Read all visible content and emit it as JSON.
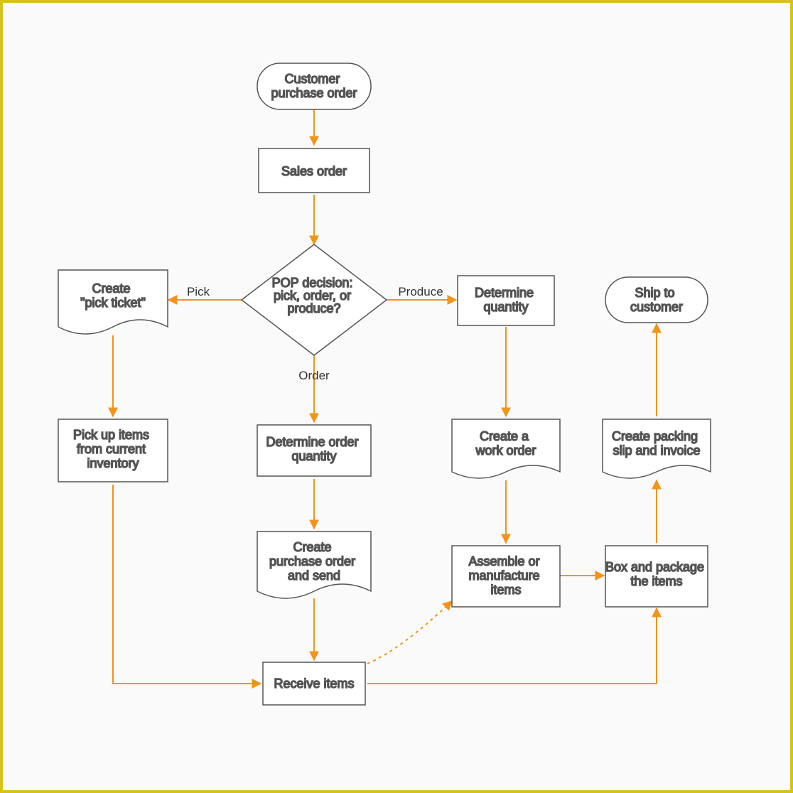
{
  "nodes": {
    "start": "聽Customer purchase order",
    "sales_order": "Sales order",
    "decision": "POP decision: pick, order, or produce?",
    "create_pick": "Create \"pick ticket\"",
    "det_qty": "Determine quantity",
    "ship": "Ship to customer",
    "pickup": "Pick up items from current inventory",
    "det_order_qty": "Determine order quantity",
    "work_order": "Create a work order",
    "packing_slip": "Create packing slip and invoice",
    "create_po": "Create purchase order and send",
    "assemble": "Assemble or manufacture items",
    "box": "Box and package the items",
    "receive": "Receive items"
  },
  "edges": {
    "pick": "Pick",
    "order": "Order",
    "produce": "Produce"
  },
  "colors": {
    "arrow": "#f2941a",
    "shape": "#555",
    "text": "#333",
    "border": "#d7c21b"
  }
}
